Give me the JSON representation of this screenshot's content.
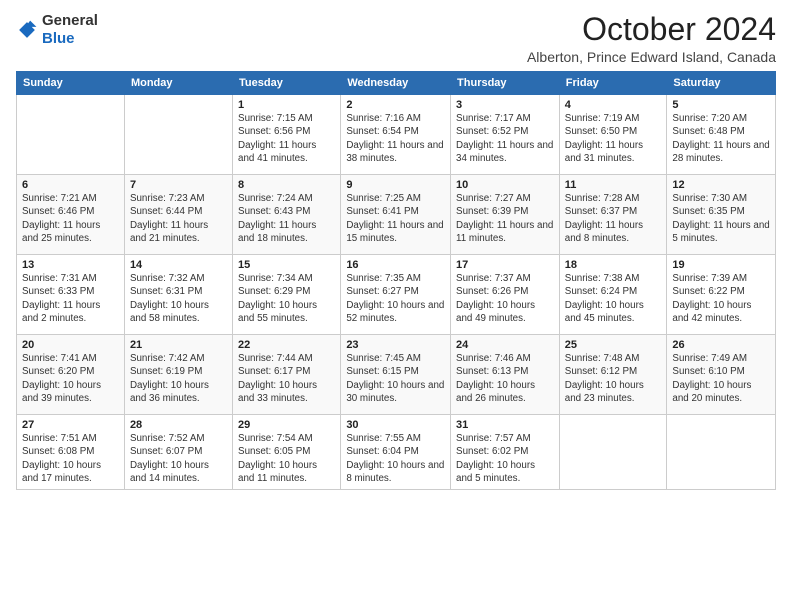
{
  "logo": {
    "general": "General",
    "blue": "Blue"
  },
  "title": "October 2024",
  "subtitle": "Alberton, Prince Edward Island, Canada",
  "weekdays": [
    "Sunday",
    "Monday",
    "Tuesday",
    "Wednesday",
    "Thursday",
    "Friday",
    "Saturday"
  ],
  "weeks": [
    [
      {
        "day": "",
        "sunrise": "",
        "sunset": "",
        "daylight": ""
      },
      {
        "day": "",
        "sunrise": "",
        "sunset": "",
        "daylight": ""
      },
      {
        "day": "1",
        "sunrise": "Sunrise: 7:15 AM",
        "sunset": "Sunset: 6:56 PM",
        "daylight": "Daylight: 11 hours and 41 minutes."
      },
      {
        "day": "2",
        "sunrise": "Sunrise: 7:16 AM",
        "sunset": "Sunset: 6:54 PM",
        "daylight": "Daylight: 11 hours and 38 minutes."
      },
      {
        "day": "3",
        "sunrise": "Sunrise: 7:17 AM",
        "sunset": "Sunset: 6:52 PM",
        "daylight": "Daylight: 11 hours and 34 minutes."
      },
      {
        "day": "4",
        "sunrise": "Sunrise: 7:19 AM",
        "sunset": "Sunset: 6:50 PM",
        "daylight": "Daylight: 11 hours and 31 minutes."
      },
      {
        "day": "5",
        "sunrise": "Sunrise: 7:20 AM",
        "sunset": "Sunset: 6:48 PM",
        "daylight": "Daylight: 11 hours and 28 minutes."
      }
    ],
    [
      {
        "day": "6",
        "sunrise": "Sunrise: 7:21 AM",
        "sunset": "Sunset: 6:46 PM",
        "daylight": "Daylight: 11 hours and 25 minutes."
      },
      {
        "day": "7",
        "sunrise": "Sunrise: 7:23 AM",
        "sunset": "Sunset: 6:44 PM",
        "daylight": "Daylight: 11 hours and 21 minutes."
      },
      {
        "day": "8",
        "sunrise": "Sunrise: 7:24 AM",
        "sunset": "Sunset: 6:43 PM",
        "daylight": "Daylight: 11 hours and 18 minutes."
      },
      {
        "day": "9",
        "sunrise": "Sunrise: 7:25 AM",
        "sunset": "Sunset: 6:41 PM",
        "daylight": "Daylight: 11 hours and 15 minutes."
      },
      {
        "day": "10",
        "sunrise": "Sunrise: 7:27 AM",
        "sunset": "Sunset: 6:39 PM",
        "daylight": "Daylight: 11 hours and 11 minutes."
      },
      {
        "day": "11",
        "sunrise": "Sunrise: 7:28 AM",
        "sunset": "Sunset: 6:37 PM",
        "daylight": "Daylight: 11 hours and 8 minutes."
      },
      {
        "day": "12",
        "sunrise": "Sunrise: 7:30 AM",
        "sunset": "Sunset: 6:35 PM",
        "daylight": "Daylight: 11 hours and 5 minutes."
      }
    ],
    [
      {
        "day": "13",
        "sunrise": "Sunrise: 7:31 AM",
        "sunset": "Sunset: 6:33 PM",
        "daylight": "Daylight: 11 hours and 2 minutes."
      },
      {
        "day": "14",
        "sunrise": "Sunrise: 7:32 AM",
        "sunset": "Sunset: 6:31 PM",
        "daylight": "Daylight: 10 hours and 58 minutes."
      },
      {
        "day": "15",
        "sunrise": "Sunrise: 7:34 AM",
        "sunset": "Sunset: 6:29 PM",
        "daylight": "Daylight: 10 hours and 55 minutes."
      },
      {
        "day": "16",
        "sunrise": "Sunrise: 7:35 AM",
        "sunset": "Sunset: 6:27 PM",
        "daylight": "Daylight: 10 hours and 52 minutes."
      },
      {
        "day": "17",
        "sunrise": "Sunrise: 7:37 AM",
        "sunset": "Sunset: 6:26 PM",
        "daylight": "Daylight: 10 hours and 49 minutes."
      },
      {
        "day": "18",
        "sunrise": "Sunrise: 7:38 AM",
        "sunset": "Sunset: 6:24 PM",
        "daylight": "Daylight: 10 hours and 45 minutes."
      },
      {
        "day": "19",
        "sunrise": "Sunrise: 7:39 AM",
        "sunset": "Sunset: 6:22 PM",
        "daylight": "Daylight: 10 hours and 42 minutes."
      }
    ],
    [
      {
        "day": "20",
        "sunrise": "Sunrise: 7:41 AM",
        "sunset": "Sunset: 6:20 PM",
        "daylight": "Daylight: 10 hours and 39 minutes."
      },
      {
        "day": "21",
        "sunrise": "Sunrise: 7:42 AM",
        "sunset": "Sunset: 6:19 PM",
        "daylight": "Daylight: 10 hours and 36 minutes."
      },
      {
        "day": "22",
        "sunrise": "Sunrise: 7:44 AM",
        "sunset": "Sunset: 6:17 PM",
        "daylight": "Daylight: 10 hours and 33 minutes."
      },
      {
        "day": "23",
        "sunrise": "Sunrise: 7:45 AM",
        "sunset": "Sunset: 6:15 PM",
        "daylight": "Daylight: 10 hours and 30 minutes."
      },
      {
        "day": "24",
        "sunrise": "Sunrise: 7:46 AM",
        "sunset": "Sunset: 6:13 PM",
        "daylight": "Daylight: 10 hours and 26 minutes."
      },
      {
        "day": "25",
        "sunrise": "Sunrise: 7:48 AM",
        "sunset": "Sunset: 6:12 PM",
        "daylight": "Daylight: 10 hours and 23 minutes."
      },
      {
        "day": "26",
        "sunrise": "Sunrise: 7:49 AM",
        "sunset": "Sunset: 6:10 PM",
        "daylight": "Daylight: 10 hours and 20 minutes."
      }
    ],
    [
      {
        "day": "27",
        "sunrise": "Sunrise: 7:51 AM",
        "sunset": "Sunset: 6:08 PM",
        "daylight": "Daylight: 10 hours and 17 minutes."
      },
      {
        "day": "28",
        "sunrise": "Sunrise: 7:52 AM",
        "sunset": "Sunset: 6:07 PM",
        "daylight": "Daylight: 10 hours and 14 minutes."
      },
      {
        "day": "29",
        "sunrise": "Sunrise: 7:54 AM",
        "sunset": "Sunset: 6:05 PM",
        "daylight": "Daylight: 10 hours and 11 minutes."
      },
      {
        "day": "30",
        "sunrise": "Sunrise: 7:55 AM",
        "sunset": "Sunset: 6:04 PM",
        "daylight": "Daylight: 10 hours and 8 minutes."
      },
      {
        "day": "31",
        "sunrise": "Sunrise: 7:57 AM",
        "sunset": "Sunset: 6:02 PM",
        "daylight": "Daylight: 10 hours and 5 minutes."
      },
      {
        "day": "",
        "sunrise": "",
        "sunset": "",
        "daylight": ""
      },
      {
        "day": "",
        "sunrise": "",
        "sunset": "",
        "daylight": ""
      }
    ]
  ]
}
